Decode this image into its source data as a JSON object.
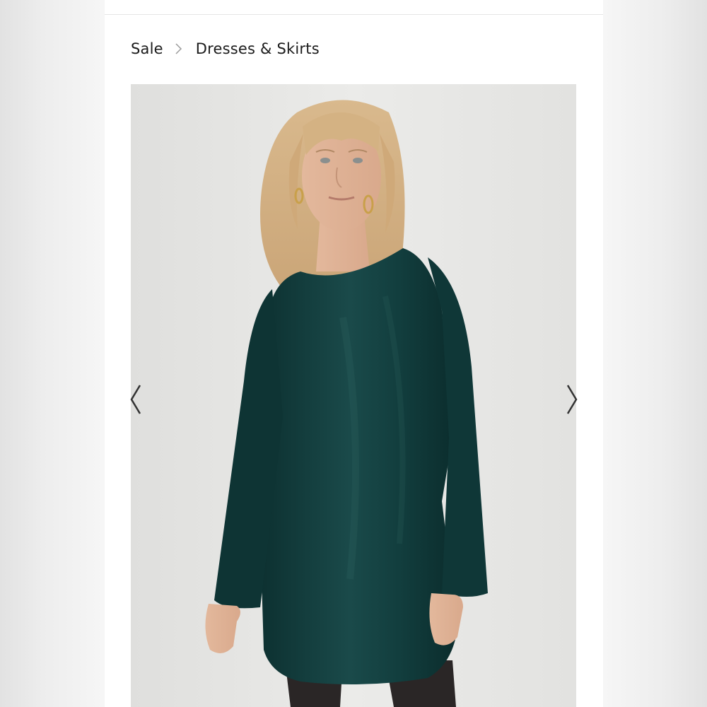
{
  "breadcrumb": {
    "items": [
      {
        "label": "Sale"
      },
      {
        "label": "Dresses & Skirts"
      }
    ],
    "separator_icon": "chevron-right-icon"
  },
  "gallery": {
    "prev_icon": "chevron-left-icon",
    "next_icon": "chevron-right-icon",
    "image_subject": "model wearing long-sleeve dark teal satin shift dress"
  },
  "colors": {
    "text": "#1b1b1b",
    "dress": "#123d3d",
    "background": "#e6e6e4"
  }
}
